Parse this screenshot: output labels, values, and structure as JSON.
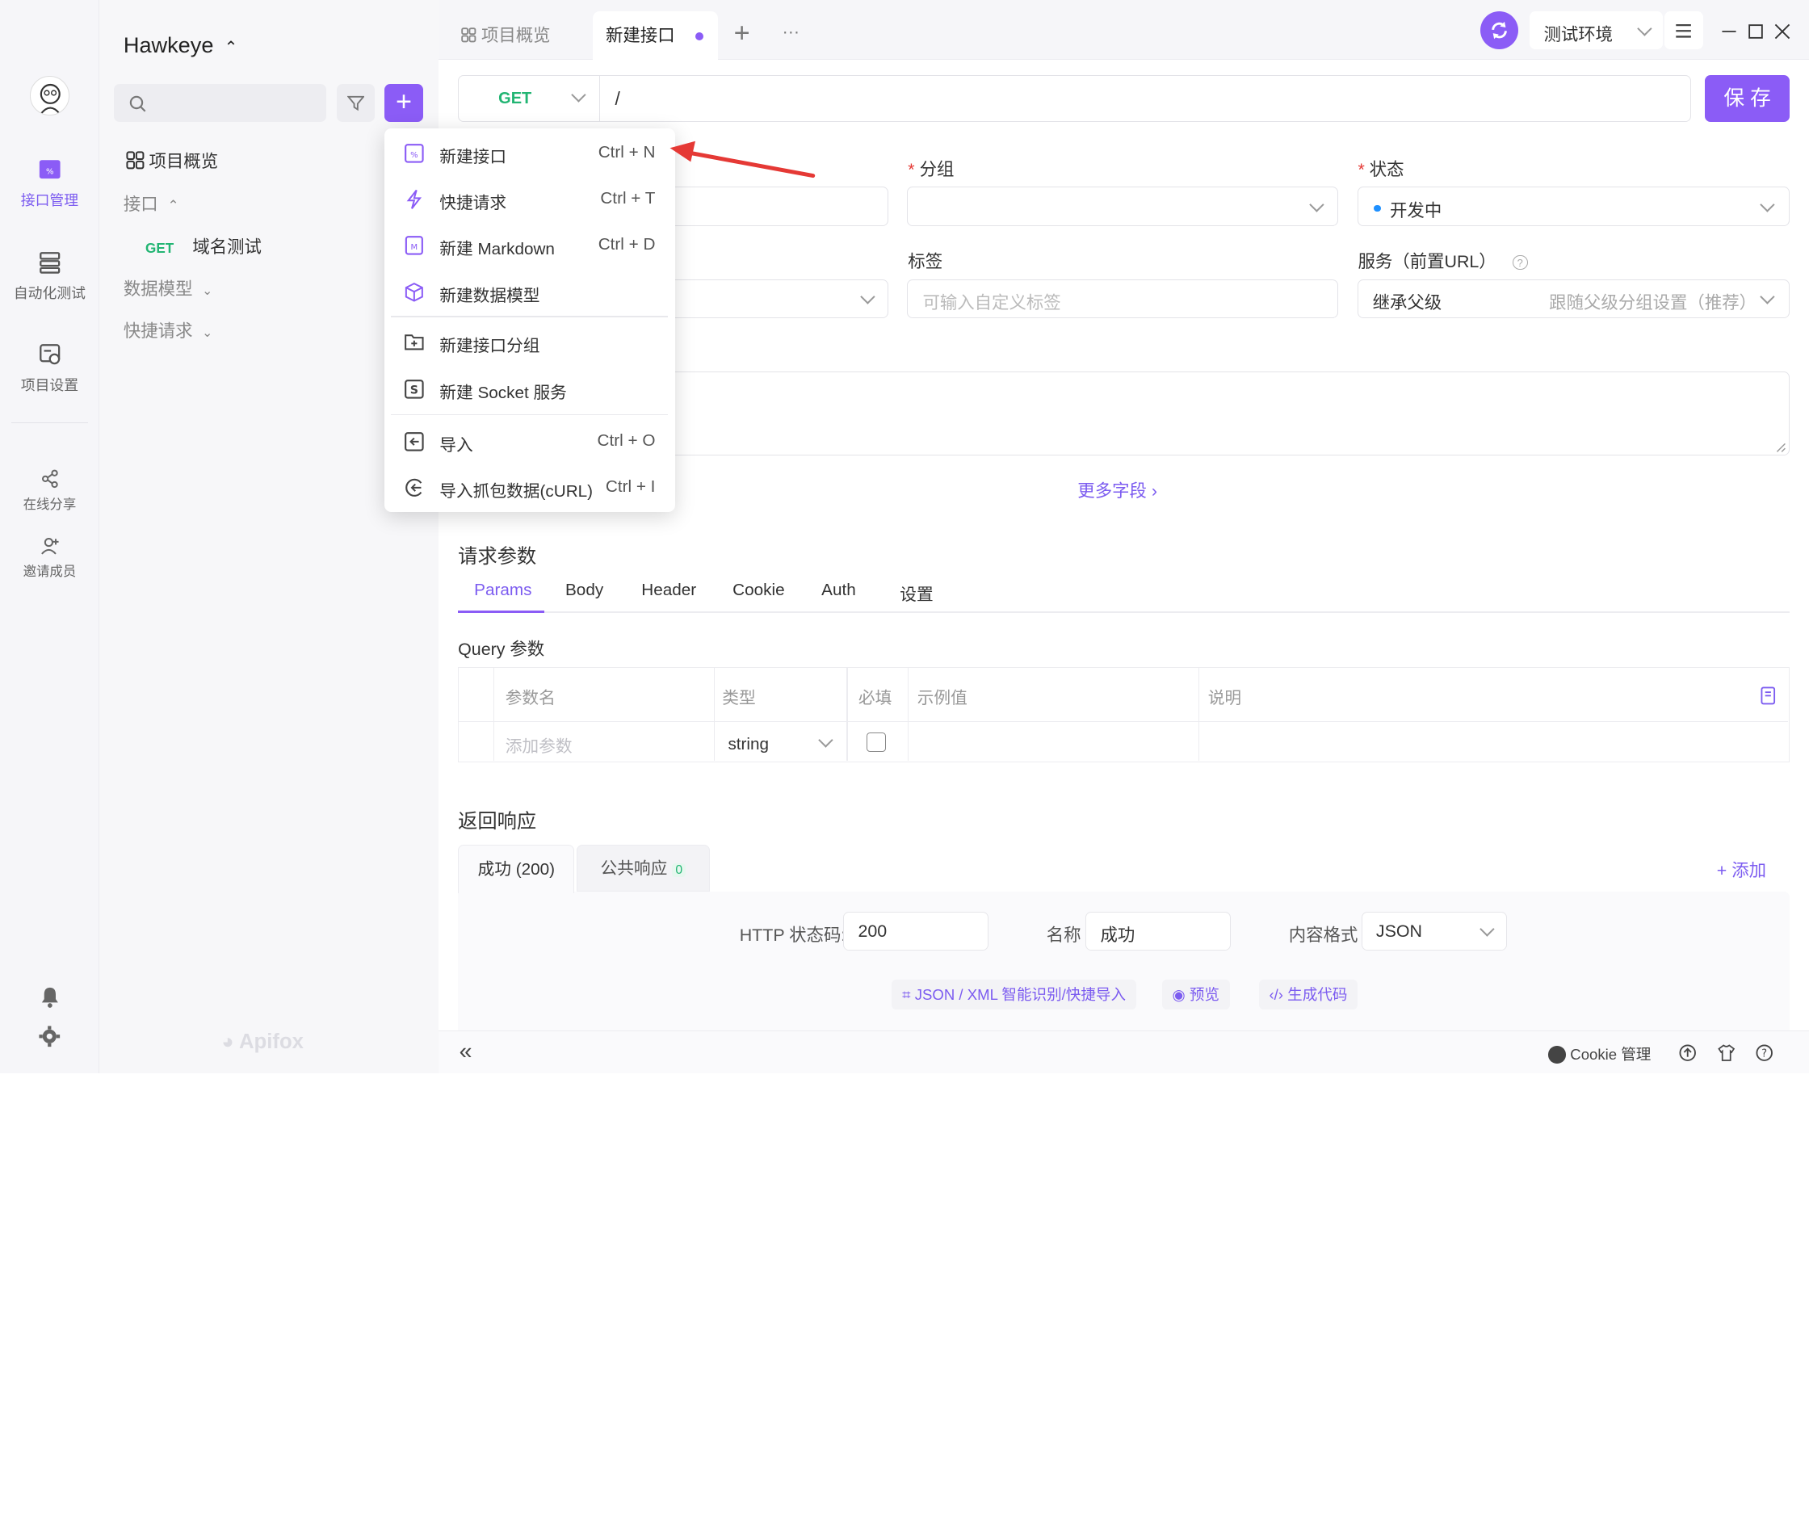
{
  "app": {
    "project_name": "Hawkeye",
    "logo_text": "Apifox"
  },
  "rail": {
    "items": [
      {
        "label": "接口管理"
      },
      {
        "label": "自动化测试"
      },
      {
        "label": "项目设置"
      },
      {
        "label": "在线分享"
      },
      {
        "label": "邀请成员"
      }
    ]
  },
  "tree": {
    "overview": "项目概览",
    "apis": "接口",
    "api_item_method": "GET",
    "api_item_name": "域名测试",
    "models": "数据模型",
    "quick": "快捷请求"
  },
  "menu": {
    "items": [
      {
        "label": "新建接口",
        "shortcut": "Ctrl + N"
      },
      {
        "label": "快捷请求",
        "shortcut": "Ctrl + T"
      },
      {
        "label": "新建 Markdown",
        "shortcut": "Ctrl + D"
      },
      {
        "label": "新建数据模型",
        "shortcut": ""
      },
      {
        "label": "新建接口分组",
        "shortcut": ""
      },
      {
        "label": "新建 Socket 服务",
        "shortcut": ""
      },
      {
        "label": "导入",
        "shortcut": "Ctrl + O"
      },
      {
        "label": "导入抓包数据(cURL)",
        "shortcut": "Ctrl + I"
      }
    ]
  },
  "tabs": {
    "overview": "项目概览",
    "new_api": "新建接口",
    "plus": "+",
    "more": "···"
  },
  "env": {
    "name": "测试环境"
  },
  "request": {
    "method": "GET",
    "path": "/",
    "save": "保 存"
  },
  "form": {
    "required_mark": "*",
    "group_label": "分组",
    "status_label": "状态",
    "status_value": "开发中",
    "tags_label": "标签",
    "tags_placeholder": "可输入自定义标签",
    "service_label": "服务（前置URL）",
    "service_value": "继承父级",
    "service_hint": "跟随父级分组设置（推荐）",
    "more_fields": "更多字段 ›"
  },
  "params": {
    "title": "请求参数",
    "tabs": [
      "Params",
      "Body",
      "Header",
      "Cookie",
      "Auth",
      "设置"
    ],
    "query_title": "Query 参数",
    "headers": [
      "参数名",
      "类型",
      "必填",
      "示例值",
      "说明"
    ],
    "add_placeholder": "添加参数",
    "type_value": "string"
  },
  "response": {
    "title": "返回响应",
    "tab_success": "成功 (200)",
    "tab_public": "公共响应",
    "public_count": "0",
    "add": "+ 添加",
    "http_code_label": "HTTP 状态码:",
    "http_code_value": "200",
    "name_label": "名称",
    "name_value": "成功",
    "format_label": "内容格式",
    "format_value": "JSON",
    "action_import": "JSON / XML 智能识别/快捷导入",
    "action_preview": "预览",
    "action_codegen": "生成代码"
  },
  "footer": {
    "collapse": "«",
    "cookie": "Cookie 管理"
  },
  "colors": {
    "accent": "#8b5cf6",
    "get": "#22b573",
    "arrow": "#e53935"
  }
}
